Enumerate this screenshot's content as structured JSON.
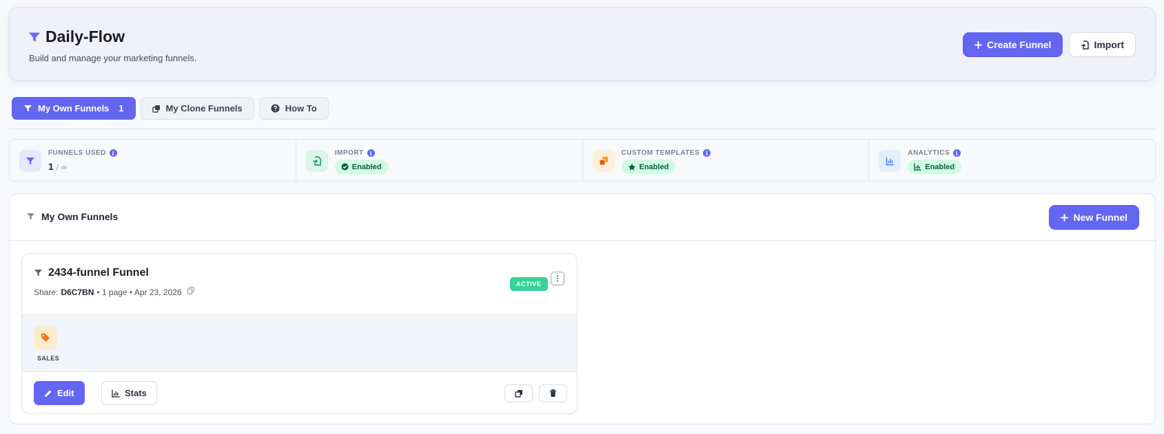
{
  "header": {
    "title": "Daily-Flow",
    "subtitle": "Build and manage your marketing funnels.",
    "create_label": "Create Funnel",
    "import_label": "Import"
  },
  "tabs": [
    {
      "label": "My Own Funnels",
      "count": "1",
      "active": true
    },
    {
      "label": "My Clone Funnels",
      "active": false
    },
    {
      "label": "How To",
      "active": false
    }
  ],
  "stats": {
    "funnels_used": {
      "label": "FUNNELS USED",
      "value": "1",
      "separator": "/",
      "limit": "∞"
    },
    "import": {
      "label": "IMPORT",
      "status": "Enabled"
    },
    "custom_templates": {
      "label": "CUSTOM TEMPLATES",
      "status": "Enabled"
    },
    "analytics": {
      "label": "ANALYTICS",
      "status": "Enabled"
    }
  },
  "panel": {
    "title": "My Own Funnels",
    "new_label": "New Funnel"
  },
  "funnel": {
    "name": "2434-funnel Funnel",
    "share_prefix": "Share:",
    "share_code": "D6C7BN",
    "meta": "• 1 page • Apr 23, 2026",
    "status": "ACTIVE",
    "category": "SALES",
    "edit_label": "Edit",
    "stats_label": "Stats"
  },
  "colors": {
    "accent": "#6366f1",
    "success_bg": "#d1fae5",
    "success_text": "#065f46",
    "active_badge": "#34d399"
  }
}
